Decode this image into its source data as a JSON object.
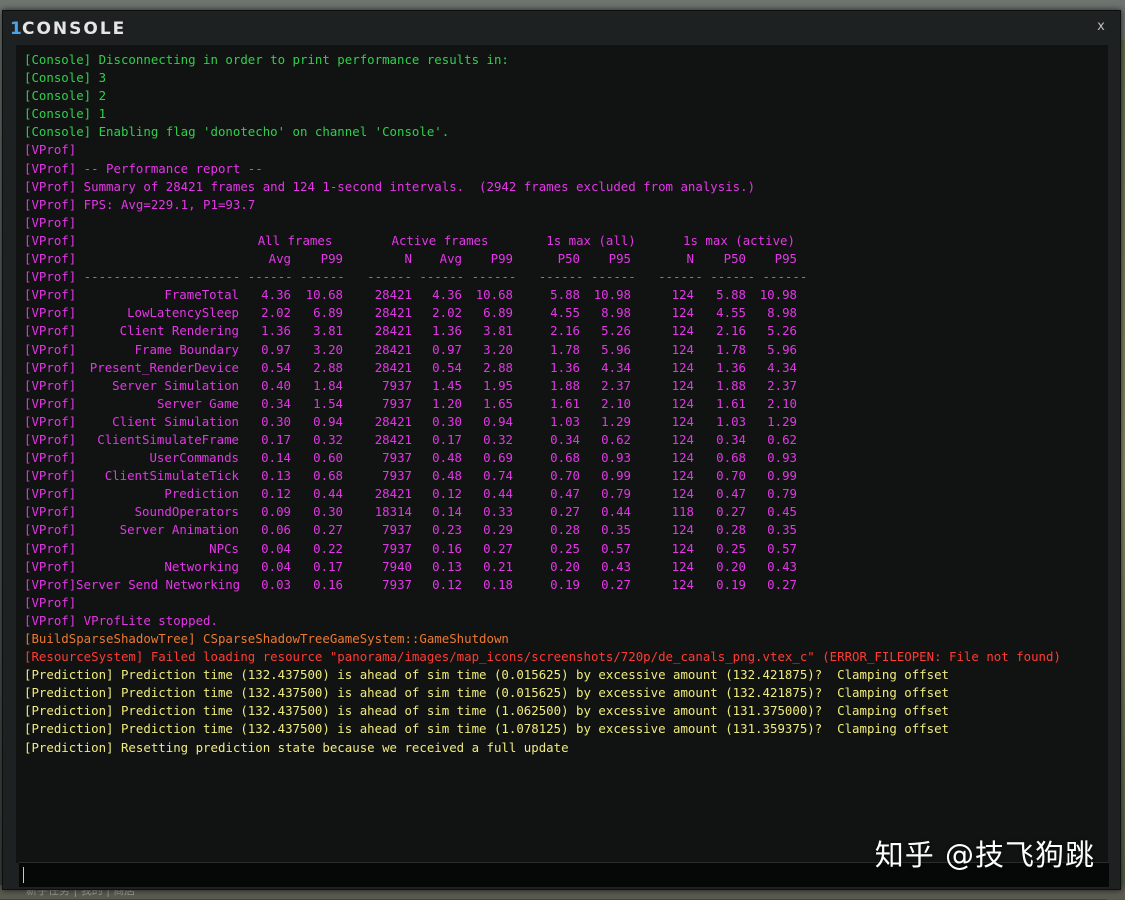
{
  "window": {
    "title_number": "1",
    "title": "CONSOLE",
    "close_label": "x"
  },
  "background": {
    "bottom_text": "新手任务 | 我的 | 商店"
  },
  "watermark": "知乎 @技飞狗跳",
  "log_lines_top": [
    {
      "color": "green",
      "text": "[Console] Disconnecting in order to print performance results in:"
    },
    {
      "color": "green",
      "text": "[Console] 3"
    },
    {
      "color": "green",
      "text": "[Console] 2"
    },
    {
      "color": "green",
      "text": "[Console] 1"
    },
    {
      "color": "green",
      "text": "[Console] Enabling flag 'donotecho' on channel 'Console'."
    },
    {
      "color": "magenta",
      "text": "[VProf]"
    },
    {
      "color": "magenta",
      "text": "[VProf] -- Performance report --"
    },
    {
      "color": "magenta",
      "text": "[VProf] Summary of 28421 frames and 124 1-second intervals.  (2942 frames excluded from analysis.)"
    },
    {
      "color": "magenta",
      "text": "[VProf] FPS: Avg=229.1, P1=93.7"
    },
    {
      "color": "magenta",
      "text": "[VProf]"
    }
  ],
  "perf_table": {
    "prefix": "[VProf]",
    "group_headers": {
      "all_frames": "All frames",
      "active_frames": "Active frames",
      "max_all": "1s max (all)",
      "max_active": "1s max (active)"
    },
    "columns": [
      "Avg",
      "P99",
      "N",
      "Avg",
      "P99",
      "P50",
      "P95",
      "N",
      "P50",
      "P95"
    ],
    "separator": "[VProf] --------------------- ------ ------   ------ ------ ------   ------ ------   ------ ------ ------",
    "rows": [
      {
        "name": "FrameTotal",
        "vals": [
          "4.36",
          "10.68",
          "28421",
          "4.36",
          "10.68",
          "5.88",
          "10.98",
          "124",
          "5.88",
          "10.98"
        ]
      },
      {
        "name": "LowLatencySleep",
        "vals": [
          "2.02",
          "6.89",
          "28421",
          "2.02",
          "6.89",
          "4.55",
          "8.98",
          "124",
          "4.55",
          "8.98"
        ]
      },
      {
        "name": "Client Rendering",
        "vals": [
          "1.36",
          "3.81",
          "28421",
          "1.36",
          "3.81",
          "2.16",
          "5.26",
          "124",
          "2.16",
          "5.26"
        ]
      },
      {
        "name": "Frame Boundary",
        "vals": [
          "0.97",
          "3.20",
          "28421",
          "0.97",
          "3.20",
          "1.78",
          "5.96",
          "124",
          "1.78",
          "5.96"
        ]
      },
      {
        "name": "Present_RenderDevice",
        "vals": [
          "0.54",
          "2.88",
          "28421",
          "0.54",
          "2.88",
          "1.36",
          "4.34",
          "124",
          "1.36",
          "4.34"
        ]
      },
      {
        "name": "Server Simulation",
        "vals": [
          "0.40",
          "1.84",
          "7937",
          "1.45",
          "1.95",
          "1.88",
          "2.37",
          "124",
          "1.88",
          "2.37"
        ]
      },
      {
        "name": "Server Game",
        "vals": [
          "0.34",
          "1.54",
          "7937",
          "1.20",
          "1.65",
          "1.61",
          "2.10",
          "124",
          "1.61",
          "2.10"
        ]
      },
      {
        "name": "Client Simulation",
        "vals": [
          "0.30",
          "0.94",
          "28421",
          "0.30",
          "0.94",
          "1.03",
          "1.29",
          "124",
          "1.03",
          "1.29"
        ]
      },
      {
        "name": "ClientSimulateFrame",
        "vals": [
          "0.17",
          "0.32",
          "28421",
          "0.17",
          "0.32",
          "0.34",
          "0.62",
          "124",
          "0.34",
          "0.62"
        ]
      },
      {
        "name": "UserCommands",
        "vals": [
          "0.14",
          "0.60",
          "7937",
          "0.48",
          "0.69",
          "0.68",
          "0.93",
          "124",
          "0.68",
          "0.93"
        ]
      },
      {
        "name": "ClientSimulateTick",
        "vals": [
          "0.13",
          "0.68",
          "7937",
          "0.48",
          "0.74",
          "0.70",
          "0.99",
          "124",
          "0.70",
          "0.99"
        ]
      },
      {
        "name": "Prediction",
        "vals": [
          "0.12",
          "0.44",
          "28421",
          "0.12",
          "0.44",
          "0.47",
          "0.79",
          "124",
          "0.47",
          "0.79"
        ]
      },
      {
        "name": "SoundOperators",
        "vals": [
          "0.09",
          "0.30",
          "18314",
          "0.14",
          "0.33",
          "0.27",
          "0.44",
          "118",
          "0.27",
          "0.45"
        ]
      },
      {
        "name": "Server Animation",
        "vals": [
          "0.06",
          "0.27",
          "7937",
          "0.23",
          "0.29",
          "0.28",
          "0.35",
          "124",
          "0.28",
          "0.35"
        ]
      },
      {
        "name": "NPCs",
        "vals": [
          "0.04",
          "0.22",
          "7937",
          "0.16",
          "0.27",
          "0.25",
          "0.57",
          "124",
          "0.25",
          "0.57"
        ]
      },
      {
        "name": "Networking",
        "vals": [
          "0.04",
          "0.17",
          "7940",
          "0.13",
          "0.21",
          "0.20",
          "0.43",
          "124",
          "0.20",
          "0.43"
        ]
      },
      {
        "name": "Server Send Networking",
        "vals": [
          "0.03",
          "0.16",
          "7937",
          "0.12",
          "0.18",
          "0.19",
          "0.27",
          "124",
          "0.19",
          "0.27"
        ]
      }
    ]
  },
  "log_lines_bottom": [
    {
      "color": "magenta",
      "text": "[VProf]"
    },
    {
      "color": "magenta",
      "text": "[VProf] VProfLite stopped."
    },
    {
      "color": "orange",
      "text": "[BuildSparseShadowTree] CSparseShadowTreeGameSystem::GameShutdown"
    },
    {
      "color": "red",
      "text": "[ResourceSystem] Failed loading resource \"panorama/images/map_icons/screenshots/720p/de_canals_png.vtex_c\" (ERROR_FILEOPEN: File not found)"
    },
    {
      "color": "yellow",
      "text": "[Prediction] Prediction time (132.437500) is ahead of sim time (0.015625) by excessive amount (132.421875)?  Clamping offset"
    },
    {
      "color": "yellow",
      "text": "[Prediction] Prediction time (132.437500) is ahead of sim time (0.015625) by excessive amount (132.421875)?  Clamping offset"
    },
    {
      "color": "yellow",
      "text": "[Prediction] Prediction time (132.437500) is ahead of sim time (1.062500) by excessive amount (131.375000)?  Clamping offset"
    },
    {
      "color": "yellow",
      "text": "[Prediction] Prediction time (132.437500) is ahead of sim time (1.078125) by excessive amount (131.359375)?  Clamping offset"
    },
    {
      "color": "yellow",
      "text": "[Prediction] Resetting prediction state because we received a full update"
    }
  ],
  "input": {
    "value": ""
  }
}
